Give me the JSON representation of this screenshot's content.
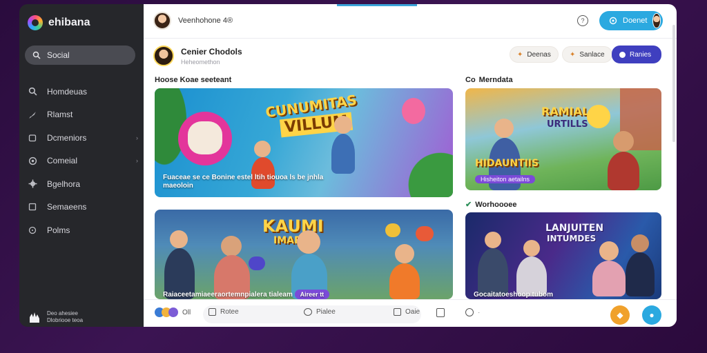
{
  "app": {
    "name": "ehibana"
  },
  "sidebar": {
    "search_label": "Social",
    "items": [
      {
        "label": "Homdeuas",
        "icon": "search-icon"
      },
      {
        "label": "Rlamst",
        "icon": "rocket-icon"
      },
      {
        "label": "Dcmeniors",
        "icon": "folder-icon",
        "has_chevron": true
      },
      {
        "label": "Comeial",
        "icon": "globe-icon",
        "has_chevron": true
      },
      {
        "label": "Bgelhora",
        "icon": "gear-icon"
      },
      {
        "label": "Semaeens",
        "icon": "square-icon"
      },
      {
        "label": "Polms",
        "icon": "circle-icon"
      }
    ],
    "footer": {
      "line1": "Deo ahesiee",
      "line2": "Dlobriooe teoa"
    }
  },
  "topbar": {
    "user_name": "Veenhohone 4®",
    "cta_label": "Doenet"
  },
  "post": {
    "title": "Cenier Chodols",
    "subtitle": "Heheomethon",
    "actions": [
      {
        "label": "Deenas",
        "icon": "bell-icon"
      },
      {
        "label": "Sanlace",
        "icon": "star-icon"
      },
      {
        "label": "Ranies",
        "icon": "user-icon",
        "primary": true
      }
    ]
  },
  "sections": {
    "left": "Hoose Koae seeteant",
    "right_top": "Merndata",
    "right_top_prefix": "Co",
    "right_bottom": "Worhoooee"
  },
  "cards": [
    {
      "headline_1": "CUNUMITAS",
      "headline_2": "VILLUM",
      "caption": "Fuaceae se ce Bonine estel ltih tiouoa ls be jnhla",
      "caption_2": "maeoloin"
    },
    {
      "headline_1": "RAMIAL",
      "headline_2": "URTILLS",
      "tag": "Hisheiton aetailns",
      "headline_3": "HIDAUNTIIS"
    },
    {
      "headline_1": "KAUMI",
      "headline_2": "IMARUS",
      "caption": "Raiaceetamiaeeraortemnpialera tialeam",
      "tag": "Aireer tt"
    },
    {
      "headline_1": "LANJUITEN",
      "headline_2": "INTUMDES",
      "caption": "Gocaitatoeshoop tubom"
    }
  ],
  "bottombar": {
    "reactions_count": "Oll",
    "actions": [
      {
        "label": "Rotee",
        "icon": "comment-icon"
      },
      {
        "label": "Pialee",
        "icon": "chat-icon"
      },
      {
        "label": "Oaie",
        "icon": "share-icon"
      }
    ]
  },
  "colors": {
    "accent": "#2ba9e0",
    "primary": "#3f3fbf",
    "sidebar_bg": "#26272b"
  }
}
